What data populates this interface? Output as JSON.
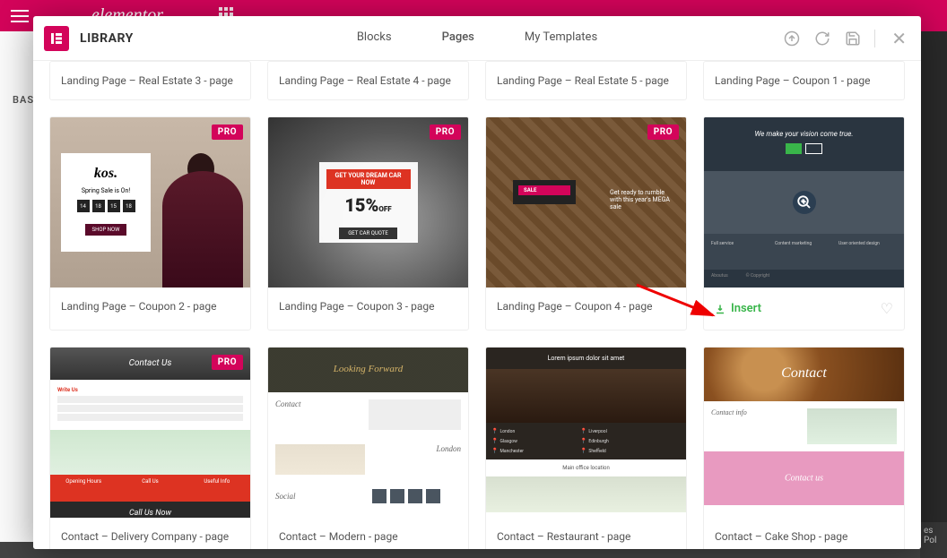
{
  "bg": {
    "logo": "elementor",
    "sidebar_basic": "BASIC",
    "bottom_right": "es Pol"
  },
  "header": {
    "title": "LIBRARY",
    "tabs": {
      "blocks": "Blocks",
      "pages": "Pages",
      "mytemplates": "My Templates"
    }
  },
  "badges": {
    "pro": "PRO"
  },
  "insert_label": "Insert",
  "row0": [
    {
      "title": "Landing Page – Real Estate 3 - page"
    },
    {
      "title": "Landing Page – Real Estate 4 - page"
    },
    {
      "title": "Landing Page – Real Estate 5 - page"
    },
    {
      "title": "Landing Page – Coupon 1 - page"
    }
  ],
  "row1": [
    {
      "title": "Landing Page – Coupon 2 - page",
      "pro": true,
      "thumb": {
        "logo": "kos.",
        "headline": "Spring Sale is On!",
        "btn": "SHOP NOW"
      }
    },
    {
      "title": "Landing Page – Coupon 3 - page",
      "pro": true,
      "thumb": {
        "headline": "GET YOUR DREAM CAR NOW",
        "discount": "15%",
        "sub": "OFF",
        "btn": "GET CAR QUOTE"
      }
    },
    {
      "title": "Landing Page – Coupon 4 - page",
      "pro": true,
      "thumb": {
        "sale": "SALE",
        "txt": "Get ready to rumble with this year's MEGA sale"
      }
    },
    {
      "insert": true,
      "thumb": {
        "hero": "We make your vision come true.",
        "cols": [
          "Full service",
          "Content marketing",
          "User oriented design"
        ],
        "foot": [
          "Aboutus",
          "© Copyright"
        ]
      }
    }
  ],
  "row2": [
    {
      "title": "Contact – Delivery Company - page",
      "pro": true,
      "thumb": {
        "hero": "Contact Us",
        "form": "Write Us",
        "cta": [
          "Opening Hours",
          "Call Us",
          "Useful Info"
        ],
        "call": "Call Us Now"
      }
    },
    {
      "title": "Contact – Modern - page",
      "thumb": {
        "hero": "Looking Forward",
        "contact": "Contact",
        "london": "London",
        "social": "Social"
      }
    },
    {
      "title": "Contact – Restaurant - page",
      "thumb": {
        "hero": "Lorem ipsum dolor sit amet",
        "locs": [
          "London",
          "Liverpool",
          "Glasgow",
          "Edinburgh",
          "Manchester",
          "Sheffield"
        ],
        "main": "Main office location"
      }
    },
    {
      "title": "Contact – Cake Shop - page",
      "thumb": {
        "hero": "Contact",
        "info": "Contact info",
        "pink": "Contact us"
      }
    }
  ]
}
